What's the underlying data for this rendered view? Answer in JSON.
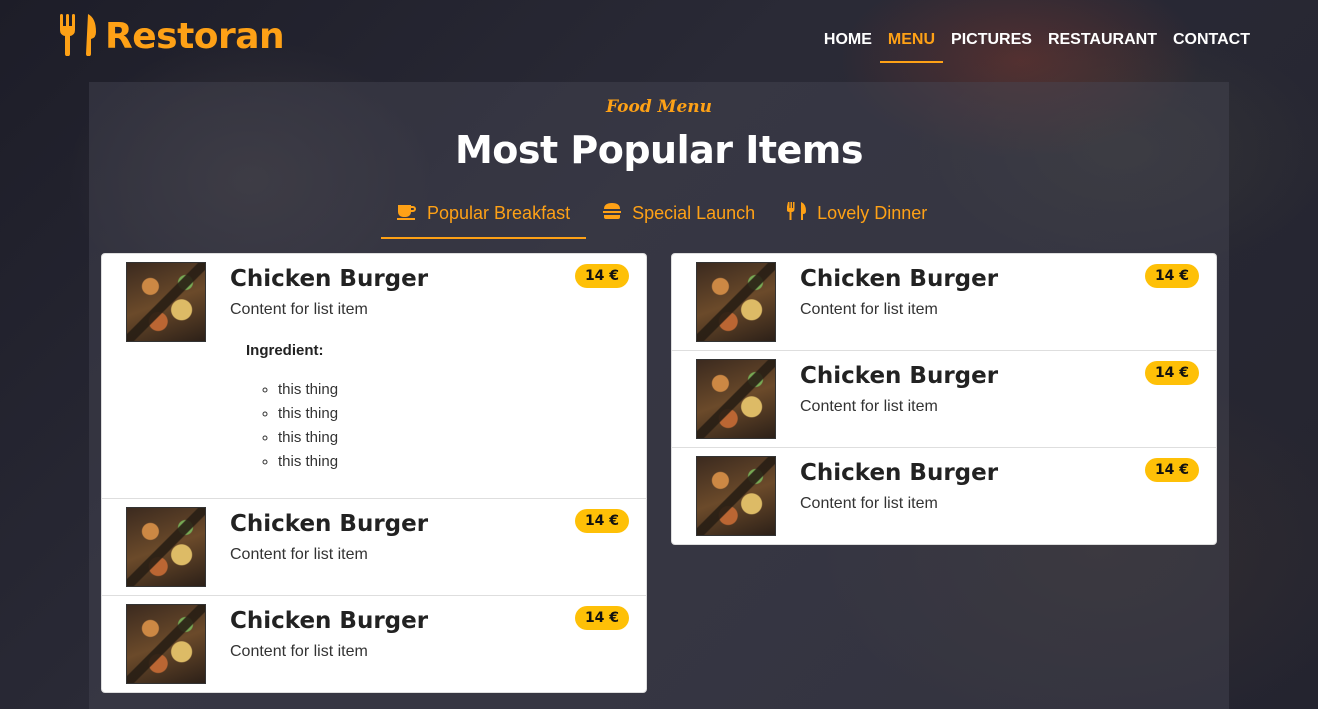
{
  "brand": {
    "name": "Restoran",
    "icon": "utensils-icon"
  },
  "nav": {
    "items": [
      {
        "label": "HOME",
        "active": false
      },
      {
        "label": "MENU",
        "active": true
      },
      {
        "label": "PICTURES",
        "active": false
      },
      {
        "label": "RESTAURANT",
        "active": false
      },
      {
        "label": "CONTACT",
        "active": false
      }
    ]
  },
  "section": {
    "subtitle": "Food Menu",
    "title": "Most Popular Items"
  },
  "tabs": [
    {
      "label": "Popular Breakfast",
      "icon": "coffee-icon",
      "active": true
    },
    {
      "label": "Special Launch",
      "icon": "hamburger-icon",
      "active": false
    },
    {
      "label": "Lovely Dinner",
      "icon": "utensils-icon",
      "active": false
    }
  ],
  "menu": {
    "left": [
      {
        "name": "Chicken Burger",
        "description": "Content for list item",
        "price": "14 €",
        "ingredient_label": "Ingredient:",
        "ingredients": [
          "this thing",
          "this thing",
          "this thing",
          "this thing"
        ]
      },
      {
        "name": "Chicken Burger",
        "description": "Content for list item",
        "price": "14 €"
      },
      {
        "name": "Chicken Burger",
        "description": "Content for list item",
        "price": "14 €"
      }
    ],
    "right": [
      {
        "name": "Chicken Burger",
        "description": "Content for list item",
        "price": "14 €"
      },
      {
        "name": "Chicken Burger",
        "description": "Content for list item",
        "price": "14 €"
      },
      {
        "name": "Chicken Burger",
        "description": "Content for list item",
        "price": "14 €"
      }
    ]
  },
  "colors": {
    "accent": "#fea116",
    "price_badge": "#fec007"
  }
}
